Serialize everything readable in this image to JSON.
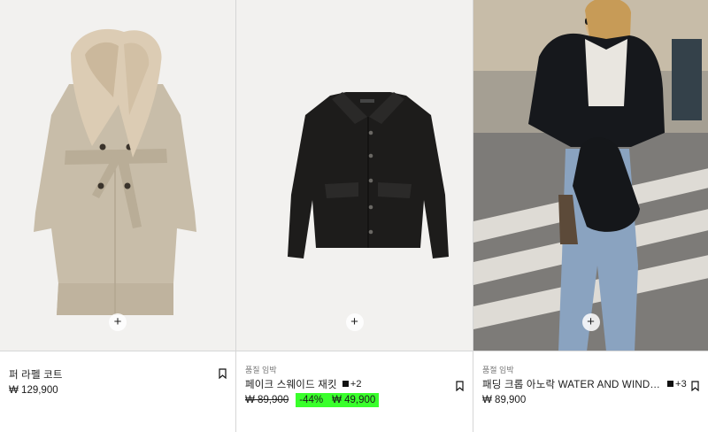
{
  "products": [
    {
      "tag": "",
      "name": "퍼 라펠 코트",
      "price": "₩ 129,900",
      "add_icon": "plus-icon",
      "bookmark_icon": "bookmark-icon"
    },
    {
      "tag": "품질 임박",
      "name": "페이크 스웨이드 재킷",
      "more_colors": "+2",
      "old_price": "₩ 89,900",
      "discount": "-44%",
      "sale_price": "₩ 49,900",
      "add_icon": "plus-icon",
      "bookmark_icon": "bookmark-icon"
    },
    {
      "tag": "품절 임박",
      "name": "패딩 크롭 아노락 WATER AND WIND PROTECTION",
      "more_colors": "+3",
      "price": "₩ 89,900",
      "add_icon": "plus-icon",
      "bookmark_icon": "bookmark-icon"
    }
  ],
  "colors": {
    "sale_highlight": "#39ff2b",
    "border": "#d6d6d6"
  }
}
